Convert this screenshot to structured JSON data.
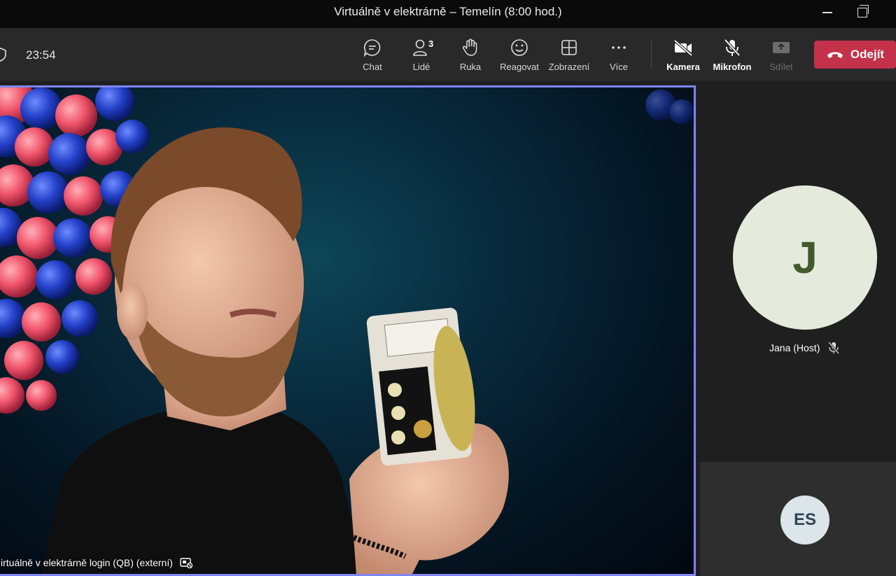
{
  "window": {
    "title": "Virtuálně v elektrárně – Temelín (8:00 hod.)"
  },
  "toolbar": {
    "timer": "23:54",
    "chat_label": "Chat",
    "people_label": "Lidé",
    "people_count": "3",
    "hand_label": "Ruka",
    "react_label": "Reagovat",
    "view_label": "Zobrazení",
    "more_label": "Více",
    "camera_label": "Kamera",
    "mic_label": "Mikrofon",
    "share_label": "Sdílet",
    "leave_label": "Odejít",
    "leave_color": "#c4314b"
  },
  "stage": {
    "presenter_name": "irtuálně v elektrárně login (QB) (externí)",
    "active_border_color": "#7f85f5"
  },
  "participants": [
    {
      "initials": "J",
      "name": "Jana (Host)",
      "muted": true
    },
    {
      "initials": "ES"
    }
  ]
}
